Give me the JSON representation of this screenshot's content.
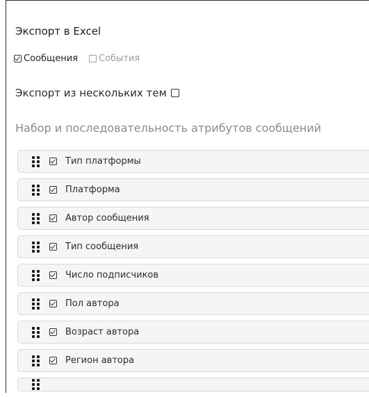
{
  "export": {
    "title": "Экспорт в Excel",
    "types": [
      {
        "label": "Сообщения",
        "checked": true,
        "enabled": true
      },
      {
        "label": "События",
        "checked": false,
        "enabled": false
      }
    ],
    "multi_topics": {
      "label": "Экспорт из нескольких тем",
      "checked": false
    },
    "attributes_heading": "Набор и последовательность атрибутов сообщений",
    "attributes": [
      {
        "label": "Тип платформы",
        "checked": true
      },
      {
        "label": "Платформа",
        "checked": true
      },
      {
        "label": "Автор сообщения",
        "checked": true
      },
      {
        "label": "Тип сообщения",
        "checked": true
      },
      {
        "label": "Число подписчиков",
        "checked": true
      },
      {
        "label": "Пол автора",
        "checked": true
      },
      {
        "label": "Возраст автора",
        "checked": true
      },
      {
        "label": "Регион автора",
        "checked": true
      }
    ]
  }
}
